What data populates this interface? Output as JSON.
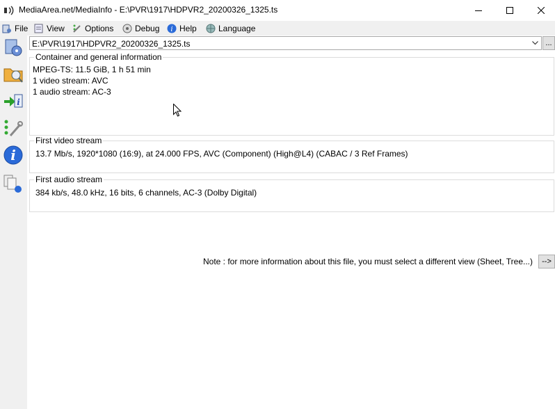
{
  "window": {
    "title": "MediaArea.net/MediaInfo - E:\\PVR\\1917\\HDPVR2_20200326_1325.ts"
  },
  "menu": {
    "items": [
      {
        "label": "File",
        "icon": "file-icon"
      },
      {
        "label": "View",
        "icon": "view-icon"
      },
      {
        "label": "Options",
        "icon": "options-icon"
      },
      {
        "label": "Debug",
        "icon": "debug-icon"
      },
      {
        "label": "Help",
        "icon": "help-icon"
      },
      {
        "label": "Language",
        "icon": "language-icon"
      }
    ]
  },
  "toolbar": {
    "buttons": [
      "open-file-icon",
      "open-folder-icon",
      "export-icon",
      "preferences-icon",
      "about-icon",
      "knowledge-base-icon"
    ]
  },
  "file_selector": {
    "value": "E:\\PVR\\1917\\HDPVR2_20200326_1325.ts",
    "browse_label": "..."
  },
  "sections": {
    "general": {
      "title": "Container and general information",
      "lines": [
        "MPEG-TS: 11.5 GiB, 1 h 51 min",
        "1 video stream: AVC",
        "1 audio stream: AC-3"
      ]
    },
    "video": {
      "title": "First video stream",
      "line": "13.7 Mb/s, 1920*1080 (16:9), at 24.000 FPS, AVC (Component) (High@L4) (CABAC / 3 Ref Frames)"
    },
    "audio": {
      "title": "First audio stream",
      "line": "384 kb/s, 48.0 kHz, 16 bits, 6 channels, AC-3 (Dolby Digital)"
    }
  },
  "note": {
    "text": "Note : for more information about this file, you must select a different view (Sheet, Tree...)",
    "button_label": "-->"
  }
}
